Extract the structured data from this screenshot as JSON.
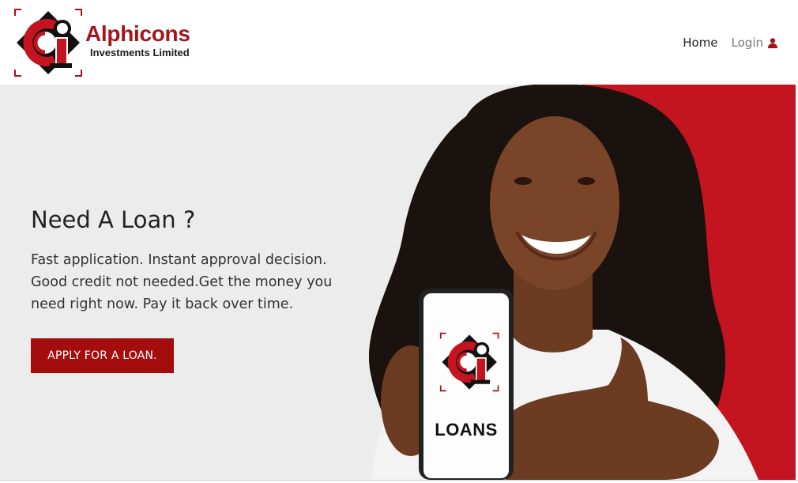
{
  "header": {
    "brand_name": "Alphicons",
    "brand_subtitle": "Investments Limited",
    "nav": {
      "home_label": "Home",
      "login_label": "Login"
    }
  },
  "hero": {
    "title": "Need A Loan ?",
    "text": "Fast application. Instant approval decision. Good credit not needed.Get the money you need right now. Pay it back over time.",
    "button_label": "APPLY FOR A LOAN.",
    "phone_label": "LOANS"
  },
  "icons": {
    "logo": "alphicons-logo-icon",
    "user": "user-icon"
  },
  "colors": {
    "brand_red": "#a3141b",
    "button_red": "#a30d0d",
    "panel_red": "#c4141f",
    "hero_bg": "#ececec"
  }
}
